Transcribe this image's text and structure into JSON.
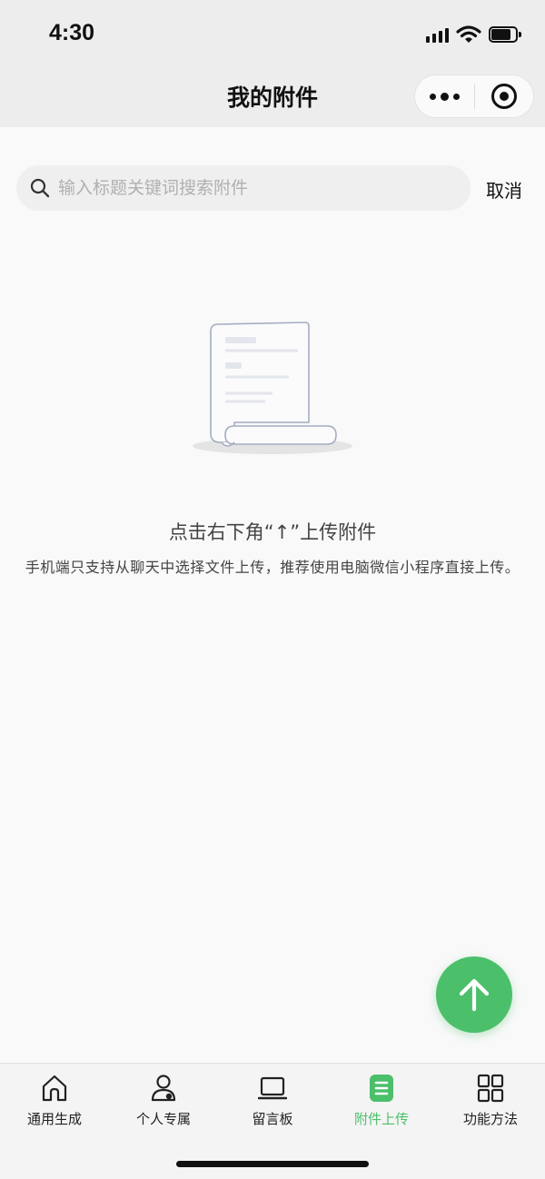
{
  "status_bar": {
    "time": "4:30"
  },
  "nav": {
    "title": "我的附件",
    "more_icon": "more-dots-icon",
    "close_icon": "target-circle-icon"
  },
  "search": {
    "placeholder": "输入标题关键词搜索附件",
    "value": "",
    "cancel_label": "取消"
  },
  "empty_state": {
    "title": "点击右下角“↑”上传附件",
    "description": "手机端只支持从聊天中选择文件上传，推荐使用电脑微信小程序直接上传。"
  },
  "fab": {
    "icon": "arrow-up-icon"
  },
  "tabbar": {
    "items": [
      {
        "label": "通用生成",
        "icon": "home-icon"
      },
      {
        "label": "个人专属",
        "icon": "user-icon"
      },
      {
        "label": "留言板",
        "icon": "laptop-icon"
      },
      {
        "label": "附件上传",
        "icon": "document-icon",
        "active": true
      },
      {
        "label": "功能方法",
        "icon": "grid-icon"
      }
    ]
  },
  "colors": {
    "accent": "#4cbf6b",
    "header_bg": "#ededed",
    "page_bg": "#f9f9f9",
    "text": "#111111"
  }
}
